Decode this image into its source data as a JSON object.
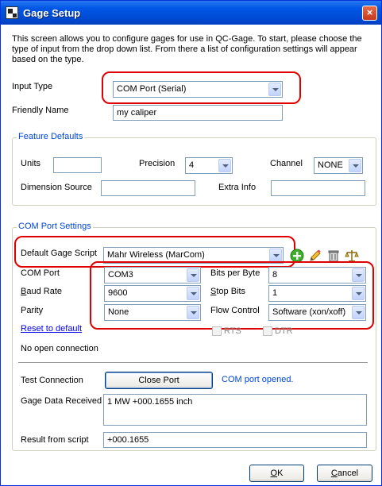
{
  "window": {
    "title": "Gage Setup",
    "close_glyph": "×"
  },
  "intro_text": "This screen allows you to configure gages for use in QC-Gage. To start, please choose the type of input from the drop down list. From there a list of configuration settings will appear based on the type.",
  "input_type": {
    "label": "Input Type",
    "value": "COM Port (Serial)"
  },
  "friendly_name": {
    "label": "Friendly Name",
    "value": "my caliper"
  },
  "feature_defaults": {
    "title": "Feature Defaults",
    "units_label": "Units",
    "units_value": "",
    "precision_label": "Precision",
    "precision_value": "4",
    "channel_label": "Channel",
    "channel_value": "NONE",
    "dimension_source_label": "Dimension Source",
    "dimension_source_value": "",
    "extra_info_label": "Extra Info",
    "extra_info_value": ""
  },
  "com_settings": {
    "title": "COM Port Settings",
    "default_script_label": "Default Gage Script",
    "default_script_value": "Mahr Wireless (MarCom)",
    "icons": [
      "add-icon",
      "edit-pencil-icon",
      "trash-icon",
      "scale-icon"
    ],
    "com_port_label": "COM Port",
    "com_port_value": "COM3",
    "baud_rate_label_first": "B",
    "baud_rate_label_rest": "aud Rate",
    "baud_rate_value": "9600",
    "parity_label": "Parity",
    "parity_value": "None",
    "bits_per_byte_label": "Bits per Byte",
    "bits_per_byte_value": "8",
    "stop_bits_label_first": "S",
    "stop_bits_label_rest": "top Bits",
    "stop_bits_value": "1",
    "flow_control_label": "Flow Control",
    "flow_control_value": "Software (xon/xoff)",
    "reset_link": "Reset to default",
    "rts_label": "RTS",
    "dtr_label": "DTR",
    "connection_status": "No open connection"
  },
  "test": {
    "test_connection_label": "Test Connection",
    "close_port_button": "Close Port",
    "port_status": "COM port opened.",
    "gage_data_label": "Gage Data Received",
    "gage_data_value": "1 MW +000.1655 inch",
    "result_label": "Result from script",
    "result_value": "+000.1655"
  },
  "footer": {
    "ok_label_first": "O",
    "ok_label_rest": "K",
    "cancel_label_first": "C",
    "cancel_label_rest": "ancel"
  },
  "colors": {
    "annotation": "#e00000",
    "link": "#0000ee",
    "group_title": "#0046d5"
  }
}
